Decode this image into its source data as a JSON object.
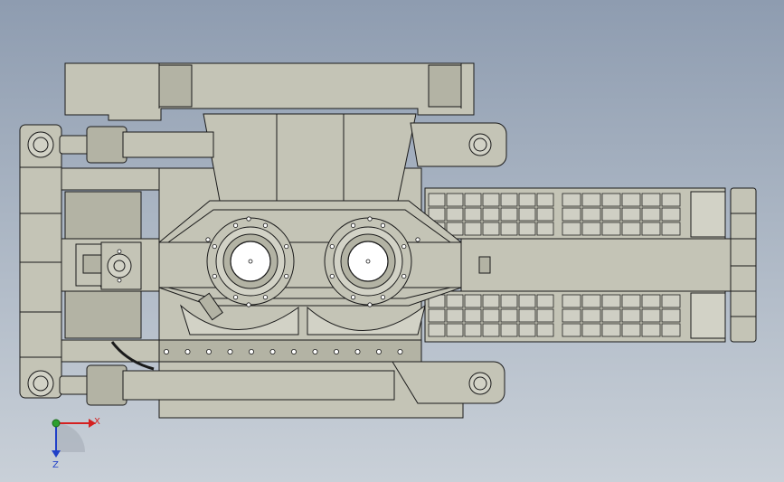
{
  "triad": {
    "x_label": "X",
    "z_label": "Z",
    "x_color": "#d42020",
    "y_color": "#2ea02e",
    "z_color": "#2040c8"
  },
  "colors": {
    "background_top": "#8e9cb0",
    "background_bottom": "#c9d0d8",
    "part_fill": "#c4c4b6",
    "edge": "#1a1a1a"
  }
}
